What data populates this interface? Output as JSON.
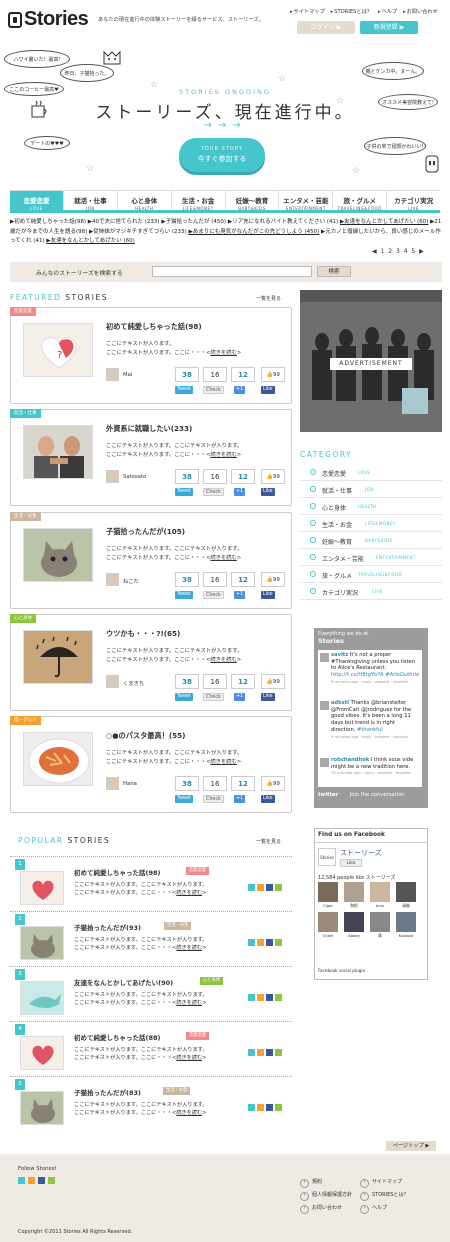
{
  "header": {
    "logo": "Stories",
    "tagline": "あなたの現在進行中の体験ストーリーを綴るサービス、ストーリーズ。",
    "links": [
      "サイトマップ",
      "STORIESとは？",
      "ヘルプ",
      "お問い合わせ"
    ],
    "login": "ログイン ▶",
    "register": "新規登録 ▶"
  },
  "hero": {
    "bubbles": [
      "ハワイ暑いた！最高!",
      "昨日、子猫拾った。",
      "ここのコーヒー最高♥",
      "デートの♥♥♥",
      "親とケンカ中。ヌーん。",
      "オススメ美容院教えて!",
      "子供の拿で寝顔かわいい!"
    ],
    "sub": "STORIES ONGOING",
    "title": "ストーリーズ、現在進行中。",
    "arrows": "→→→",
    "cta_sub": "YOUR STORY",
    "cta_main": "今すぐ参加する"
  },
  "tabs": [
    {
      "ja": "恋愛恋愛",
      "en": "LOVE"
    },
    {
      "ja": "就活・仕事",
      "en": "JOB"
    },
    {
      "ja": "心と身体",
      "en": "HEALTH"
    },
    {
      "ja": "生活・お金",
      "en": "LIFE&MONEY"
    },
    {
      "ja": "妊娠～教育",
      "en": "BABY&KIDS"
    },
    {
      "ja": "エンタメ・芸能",
      "en": "ENTERTAINMENT"
    },
    {
      "ja": "旅・グルメ",
      "en": "TRAVELING&FOOD"
    },
    {
      "ja": "カテゴリ実況",
      "en": "LIVE"
    }
  ],
  "ticker": [
    "▶初めて純愛しちゃった話(98)",
    "▶40で夫に捨てられた (233)",
    "▶子猫拾ったんだが (450)",
    "▶リア充になれるバイト教えてください (41)",
    "▶友達をなんとかしてあげたい (60)",
    "▶21歳だが今までの人生を語る(98)",
    "▶従姉妹がマジキチすぎてつらい (233)",
    "▶あまりにも臭気がなんだがこの先どうしよう (450)",
    "▶元カノと復縁したいから、良い感じのメール作ってくれ (41)",
    "▶友達をなんとかしてあげたい (60)"
  ],
  "pager": "◀ 1 2 3 4 5 ▶",
  "search": {
    "label": "みんなのストーリーズを検索する",
    "placeholder": "",
    "button": "検索"
  },
  "featured": {
    "heading_a": "FEATURED",
    "heading_b": "STORIES",
    "more": "一覧を見る",
    "cards": [
      {
        "tag": "恋愛恋愛",
        "title": "初めて純愛しちゃった話(98)",
        "line1": "ここにテキストが入ります。",
        "line2": "ここにテキストが入ります。ここに・・・",
        "more": "続きを読む",
        "author": "Mai",
        "s1": "38",
        "s2": "16",
        "s3": "12",
        "s4": "99",
        "tw": "Tweet",
        "ck": "Check",
        "g": "+1",
        "fb": "Like"
      },
      {
        "tag": "就活・仕事",
        "title": "外資系に就職したい(233)",
        "line1": "ここにテキストが入ります。ここにテキストが入ります。",
        "line2": "ここにテキストが入ります。ここに・・・",
        "more": "続きを読む",
        "author": "Satosato",
        "s1": "38",
        "s2": "16",
        "s3": "12",
        "s4": "99",
        "tw": "Tweet",
        "ck": "Check",
        "g": "+1",
        "fb": "Like"
      },
      {
        "tag": "生活・お金",
        "title": "子猫拾ったんだが(105)",
        "line1": "ここにテキストが入ります。ここにテキストが入ります。",
        "line2": "ここにテキストが入ります。ここに・・・",
        "more": "続きを読む",
        "author": "ねこた",
        "s1": "38",
        "s2": "16",
        "s3": "12",
        "s4": "99",
        "tw": "Tweet",
        "ck": "Check",
        "g": "+1",
        "fb": "Like"
      },
      {
        "tag": "心と身体",
        "title": "ウツかも・・・?!(65)",
        "line1": "ここにテキストが入ります。ここにテキストが入ります。",
        "line2": "ここにテキストが入ります。ここに・・・",
        "more": "続きを読む",
        "author": "くまきち",
        "s1": "38",
        "s2": "16",
        "s3": "12",
        "s4": "99",
        "tw": "Tweet",
        "ck": "Check",
        "g": "+1",
        "fb": "Like"
      },
      {
        "tag": "旅・グルメ",
        "title": "○●のパスタ最高！(55)",
        "line1": "ここにテキストが入ります。ここにテキストが入ります。",
        "line2": "ここにテキストが入ります。ここに・・・",
        "more": "続きを読む",
        "author": "Hana",
        "s1": "38",
        "s2": "16",
        "s3": "12",
        "s4": "99",
        "tw": "Tweet",
        "ck": "Check",
        "g": "+1",
        "fb": "Like"
      }
    ]
  },
  "popular": {
    "heading_a": "POPULAR",
    "heading_b": "STORIES",
    "more": "一覧を見る",
    "items": [
      {
        "rank": "1",
        "title": "初めて純愛しちゃった話(98)",
        "tag": "恋愛恋愛",
        "line1": "ここにテキストが入ります。ここにテキストが入ります。",
        "line2": "ここにテキストが入ります。ここに・・・",
        "more": "続きを読む"
      },
      {
        "rank": "2",
        "title": "子猫拾ったんだが(93)",
        "tag": "生活・お金",
        "line1": "ここにテキストが入ります。ここにテキストが入ります。",
        "line2": "ここにテキストが入ります。ここに・・・",
        "more": "続きを読む"
      },
      {
        "rank": "3",
        "title": "友達をなんとかしてあげたい(90)",
        "tag": "心と身体",
        "line1": "ここにテキストが入ります。ここにテキストが入ります。",
        "line2": "ここにテキストが入ります。ここに・・・",
        "more": "続きを読む"
      },
      {
        "rank": "4",
        "title": "初めて純愛しちゃった話(88)",
        "tag": "恋愛恋愛",
        "line1": "ここにテキストが入ります。ここにテキストが入ります。",
        "line2": "ここにテキストが入ります。ここに・・・",
        "more": "続きを読む"
      },
      {
        "rank": "5",
        "title": "子猫拾ったんだが(83)",
        "tag": "生活・お金",
        "line1": "ここにテキストが入ります。ここにテキストが入ります。",
        "line2": "ここにテキストが入ります。ここに・・・",
        "more": "続きを読む"
      }
    ]
  },
  "ad": {
    "label": "ADVERTISEMENT"
  },
  "category": {
    "heading": "CATEGORY",
    "items": [
      {
        "ja": "恋愛恋愛",
        "en": "LOVE"
      },
      {
        "ja": "就活・仕事",
        "en": "JOB"
      },
      {
        "ja": "心と身体",
        "en": "HEALTH"
      },
      {
        "ja": "生活・お金",
        "en": "LIFE&MONEY"
      },
      {
        "ja": "妊娠～教育",
        "en": "BABY&KIDS"
      },
      {
        "ja": "エンタメ・芸能",
        "en": "ENTERTAINMENT"
      },
      {
        "ja": "旅・グルメ",
        "en": "TRAVELING&FOOD"
      },
      {
        "ja": "カテゴリ実況",
        "en": "LIVE"
      }
    ]
  },
  "twitter": {
    "head1": "Everything we do at",
    "head2": "Stories",
    "foot_logo": "twitter",
    "foot": "Join the conversation",
    "tweets": [
      {
        "user": "savitz",
        "text": "It's not a proper #Thanksgiving unless you listen to Alice's Restaurant.",
        "link": "http://t.co/H8tgYbYA #ArloGuthrie",
        "meta": "8 minutes ago · reply · retweet · favorite"
      },
      {
        "user": "adkstl",
        "text": "Thanks @brianstelter @FromCarl @jrodriguez for the good vibes. It's been a long 11 days but trend is in right direction.",
        "link": "#thankful",
        "meta": "9 minutes ago · reply · retweet · favorite"
      },
      {
        "user": "robchandhok",
        "text": "I think sous vide might be a new tradition here.",
        "link": "",
        "meta": "38 minutes ago · reply · retweet · favorite"
      }
    ]
  },
  "facebook": {
    "heading": "Find us on Facebook",
    "name": "ストーリーズ",
    "like": "Like",
    "count": "12,584 people like ストーリーズ",
    "friends": [
      "Cigar",
      "和帆",
      "Amy",
      "瑞勝",
      "Chieh",
      "Abbey",
      "珠",
      "Kaizozo"
    ],
    "plugin": "Facebook social plugin"
  },
  "footer": {
    "pagetop": "ページトップ ▶",
    "follow": "Follow Stories!",
    "links": [
      "規約",
      "個人情報保護方針",
      "お問い合わせ",
      "サイトマップ",
      "STORIESとは？",
      "ヘルプ"
    ],
    "copyright": "Copyright ©2011 Stories All Rights Reserved."
  },
  "colors": {
    "accent": "#45c6cd",
    "beige": "#efebe4",
    "love": "#f08a8a",
    "job": "#45c6cd",
    "money": "#c9b7a0",
    "health": "#8cc63f",
    "food": "#f6a02d"
  }
}
